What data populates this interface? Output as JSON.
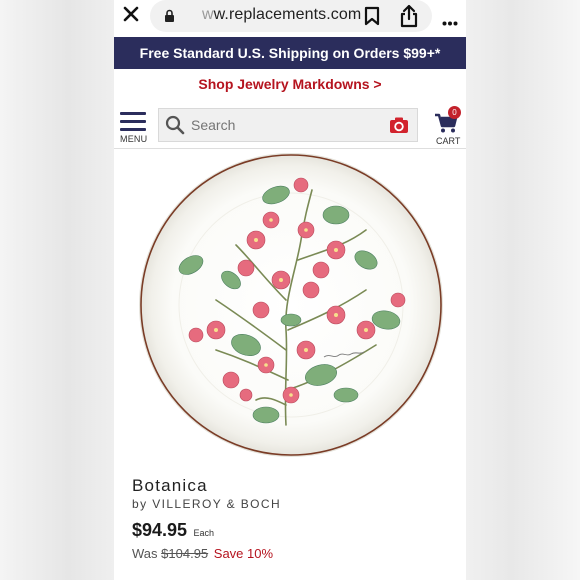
{
  "browser": {
    "url_fade": "w",
    "url_main": "w.replacements.com"
  },
  "banner": {
    "shipping": "Free Standard U.S. Shipping on Orders $99+*"
  },
  "promo": {
    "text": "Shop Jewelry Markdowns >"
  },
  "nav": {
    "menu_label": "MENU",
    "search_placeholder": "Search",
    "cart_count": "0",
    "cart_label": "CART"
  },
  "product": {
    "name": "Botanica",
    "brand": "by VILLEROY & BOCH",
    "price": "$94.95",
    "price_unit": "Each",
    "was_label": "Was",
    "was_price": "$104.95",
    "save_text": "Save 10%"
  },
  "colors": {
    "navy": "#2b2d5c",
    "promo_red": "#b5141f",
    "badge_red": "#c3222c"
  }
}
